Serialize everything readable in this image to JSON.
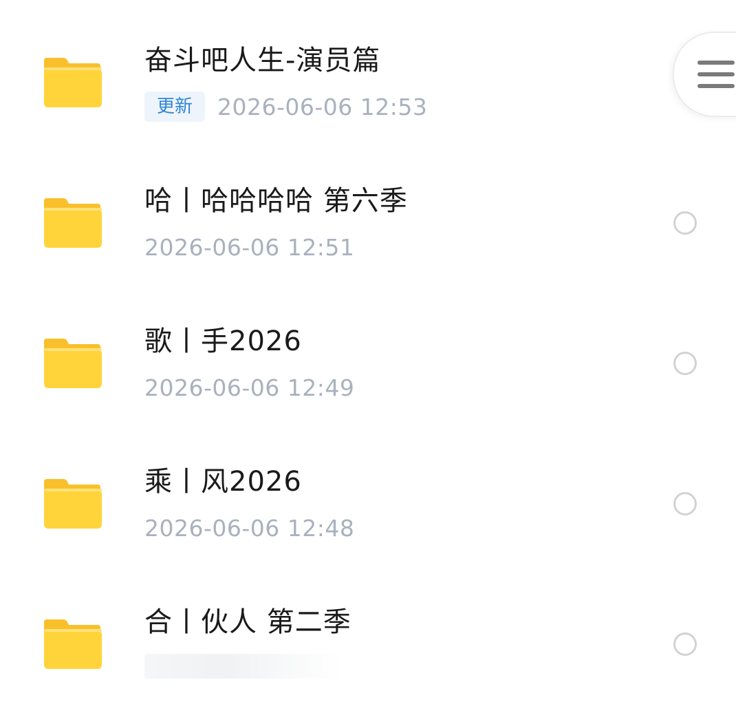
{
  "colors": {
    "folder": "#FFD43B",
    "badge_text": "#2F86D6",
    "badge_bg": "#EEF4FB",
    "date_text": "#A9B1BD",
    "name_text": "#1A1A1A"
  },
  "menu_button": {
    "icon": "hamburger-menu-icon"
  },
  "items": [
    {
      "name": "奋斗吧人生-演员篇",
      "badge": "更新",
      "date": "2026-06-06  12:53",
      "icon": "folder-icon"
    },
    {
      "name": "哈丨哈哈哈哈 第六季",
      "date": "2026-06-06  12:51",
      "icon": "folder-icon"
    },
    {
      "name": "歌丨手2026",
      "date": "2026-06-06  12:49",
      "icon": "folder-icon"
    },
    {
      "name": "乘丨风2026",
      "date": "2026-06-06  12:48",
      "icon": "folder-icon"
    },
    {
      "name": "合丨伙人 第二季",
      "icon": "folder-icon"
    }
  ]
}
